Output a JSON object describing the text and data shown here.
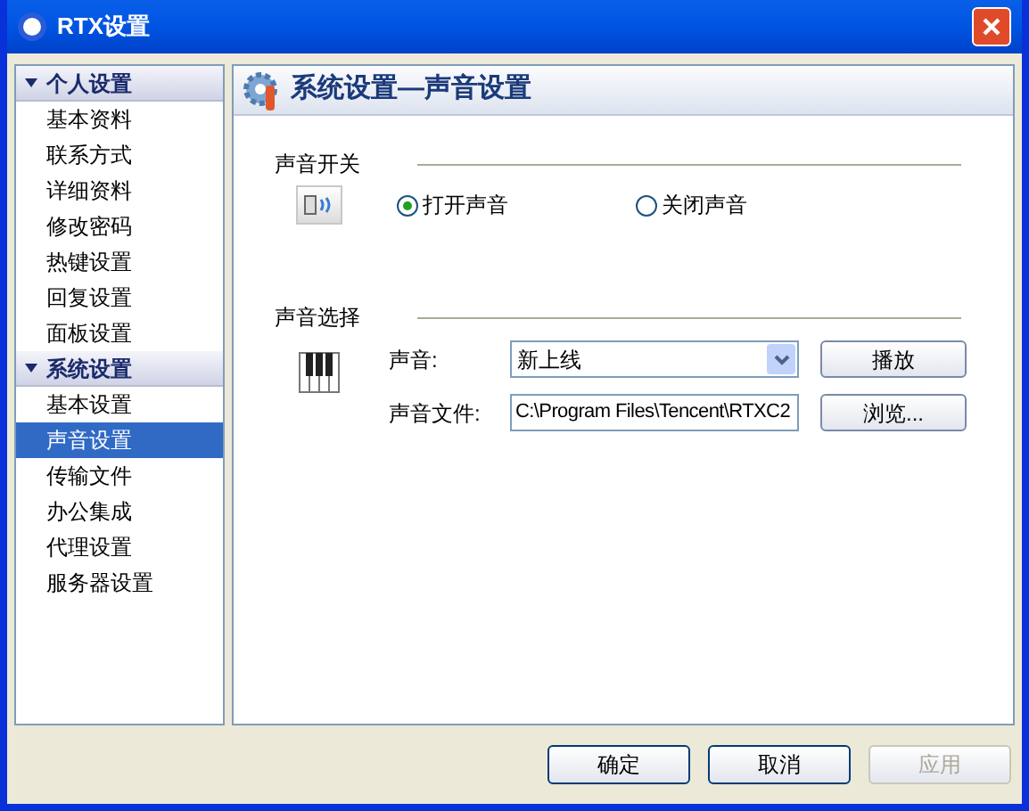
{
  "window": {
    "title": "RTX设置"
  },
  "sidebar": {
    "groups": [
      {
        "label": "个人设置",
        "expanded": true,
        "items": [
          {
            "label": "基本资料",
            "selected": false
          },
          {
            "label": "联系方式",
            "selected": false
          },
          {
            "label": "详细资料",
            "selected": false
          },
          {
            "label": "修改密码",
            "selected": false
          },
          {
            "label": "热键设置",
            "selected": false
          },
          {
            "label": "回复设置",
            "selected": false
          },
          {
            "label": "面板设置",
            "selected": false
          }
        ]
      },
      {
        "label": "系统设置",
        "expanded": true,
        "items": [
          {
            "label": "基本设置",
            "selected": false
          },
          {
            "label": "声音设置",
            "selected": true
          },
          {
            "label": "传输文件",
            "selected": false
          },
          {
            "label": "办公集成",
            "selected": false
          },
          {
            "label": "代理设置",
            "selected": false
          },
          {
            "label": "服务器设置",
            "selected": false
          }
        ]
      }
    ]
  },
  "panel": {
    "title": "系统设置—声音设置",
    "sound_switch": {
      "label": "声音开关",
      "options": [
        {
          "label": "打开声音",
          "selected": true
        },
        {
          "label": "关闭声音",
          "selected": false
        }
      ]
    },
    "sound_select": {
      "label": "声音选择",
      "sound_label": "声音:",
      "sound_value": "新上线",
      "play_button": "播放",
      "file_label": "声音文件:",
      "file_value": "C:\\Program Files\\Tencent\\RTXC2",
      "browse_button": "浏览..."
    }
  },
  "buttons": [
    {
      "label": "确定",
      "disabled": false
    },
    {
      "label": "取消",
      "disabled": false
    },
    {
      "label": "应用",
      "disabled": true
    }
  ]
}
